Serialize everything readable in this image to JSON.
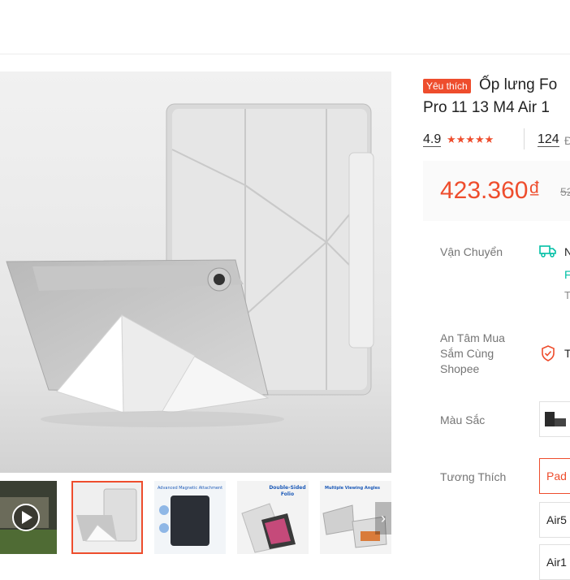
{
  "product": {
    "badge": "Yêu thích",
    "title_line1": "Ốp lưng Fo",
    "title_line2": "Pro 11 13 M4 Air 1",
    "rating": "4.9",
    "rating_stars": 5,
    "stars_text": "★★★★★",
    "review_count": "124",
    "review_suffix": "Đ",
    "price": "423.360₫",
    "price_old": "52"
  },
  "thumbnails": [
    {
      "name": "video-thumbnail",
      "caption": ""
    },
    {
      "name": "folio-stand-thumbnail",
      "caption": ""
    },
    {
      "name": "magnetic-attachment-thumbnail",
      "caption": "Advanced Magnetic Attachment"
    },
    {
      "name": "double-sided-folio-thumbnail",
      "caption": "Double-Sided Folio"
    },
    {
      "name": "viewing-angles-thumbnail",
      "caption": "Multiple Viewing Angles"
    }
  ],
  "thumb_next": "›",
  "details": {
    "shipping_label": "Vận Chuyển",
    "shipping_cut_1": "N",
    "shipping_cut_2": "F",
    "shipping_cut_3": "T",
    "guarantee_label": "An Tâm Mua Sắm Cùng Shopee",
    "guarantee_cut": "T",
    "color_label": "Màu Sắc",
    "compat_label": "Tương Thích",
    "compat_options": [
      "Pad",
      "Air5",
      "Air1"
    ]
  },
  "colors": {
    "accent": "#ee4d2d",
    "teal": "#00bfa5"
  }
}
